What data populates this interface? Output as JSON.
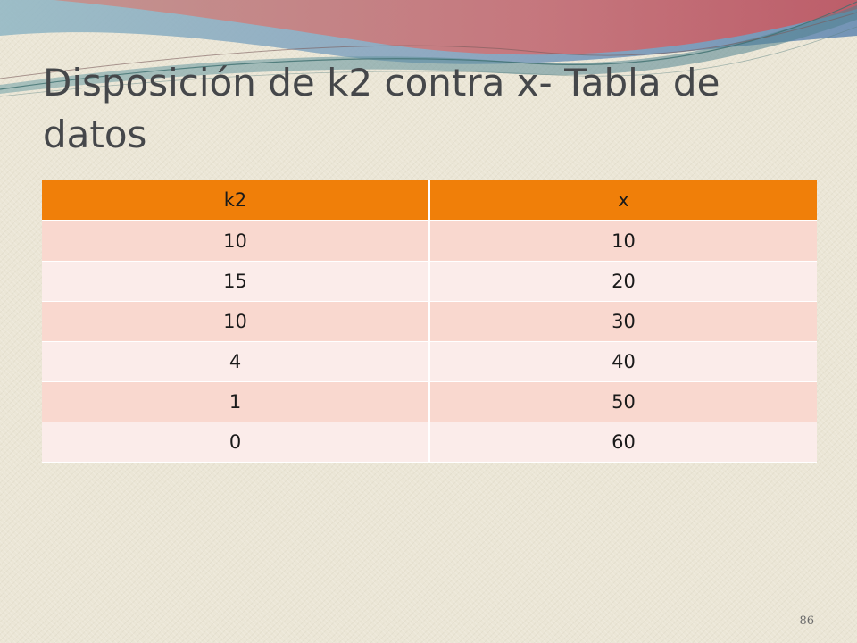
{
  "slide": {
    "title": "Disposición de k2 contra x- Tabla de datos",
    "page_number": "86"
  },
  "table": {
    "headers": [
      "k2",
      "x"
    ],
    "rows": [
      [
        "10",
        "10"
      ],
      [
        "15",
        "20"
      ],
      [
        "10",
        "30"
      ],
      [
        "4",
        "40"
      ],
      [
        "1",
        "50"
      ],
      [
        "0",
        "60"
      ]
    ]
  },
  "colors": {
    "header_background": "#f07f09",
    "row_odd_background": "#f9d8cf",
    "row_even_background": "#fbecea",
    "slide_background": "#ebe6d6",
    "title_text": "#45474a"
  }
}
